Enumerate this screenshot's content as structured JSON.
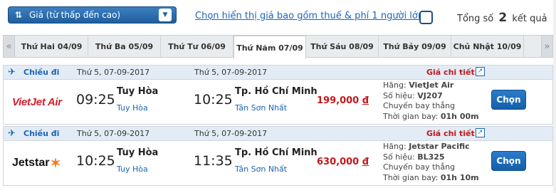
{
  "sort": {
    "label": "Giá (từ thấp đến cao)",
    "icon": "sort-ascending-icon"
  },
  "tax_option": {
    "label": "Chọn hiển thị giá bao gồm thuế & phí 1 người lớn",
    "checked": false
  },
  "total": {
    "prefix": "Tổng số",
    "count": "2",
    "suffix": "kết quả"
  },
  "days": [
    {
      "label": "Thứ Hai 04/09",
      "active": false
    },
    {
      "label": "Thứ Ba 05/09",
      "active": false
    },
    {
      "label": "Thứ Tư 06/09",
      "active": false
    },
    {
      "label": "Thứ Năm 07/09",
      "active": true
    },
    {
      "label": "Thứ Sáu 08/09",
      "active": false
    },
    {
      "label": "Thứ Bảy 09/09",
      "active": false
    },
    {
      "label": "Chủ Nhật 10/09",
      "active": false
    }
  ],
  "nav": {
    "prev": "«",
    "next": "»"
  },
  "flights": [
    {
      "direction": "Chiều đi",
      "dep_date": "Thứ 5, 07-09-2017",
      "arr_date": "Thứ 5, 07-09-2017",
      "detail_label": "Giá chi tiết",
      "airline_logo": "VietJet Air",
      "dep_time": "09:25",
      "dep_city": "Tuy Hòa",
      "dep_airport": "Tuy Hòa",
      "arr_time": "10:25",
      "arr_city": "Tp. Hồ Chí Minh",
      "arr_airport": "Tân Sơn Nhất",
      "price": "199,000",
      "currency": "đ",
      "airline_label": "Hãng:",
      "airline": "VietJet Air",
      "flight_no_label": "Số hiệu:",
      "flight_no": "VJ207",
      "type": "Chuyến bay thẳng",
      "duration_label": "Thời gian bay:",
      "duration": "01h 00m",
      "button": "Chọn"
    },
    {
      "direction": "Chiều đi",
      "dep_date": "Thứ 5, 07-09-2017",
      "arr_date": "Thứ 5, 07-09-2017",
      "detail_label": "Giá chi tiết",
      "airline_logo": "Jetstar",
      "dep_time": "10:25",
      "dep_city": "Tuy Hòa",
      "dep_airport": "Tuy Hòa",
      "arr_time": "11:35",
      "arr_city": "Tp. Hồ Chí Minh",
      "arr_airport": "Tân Sơn Nhất",
      "price": "630,000",
      "currency": "đ",
      "airline_label": "Hãng:",
      "airline": "Jetstar Pacific",
      "flight_no_label": "Số hiệu:",
      "flight_no": "BL325",
      "type": "Chuyến bay thẳng",
      "duration_label": "Thời gian bay:",
      "duration": "01h 10m",
      "button": "Chọn"
    }
  ],
  "colors": {
    "accent": "#1a64b8",
    "price": "#c0181b",
    "button": "#1f6fbf",
    "header_bg": "#e3ecf5"
  }
}
